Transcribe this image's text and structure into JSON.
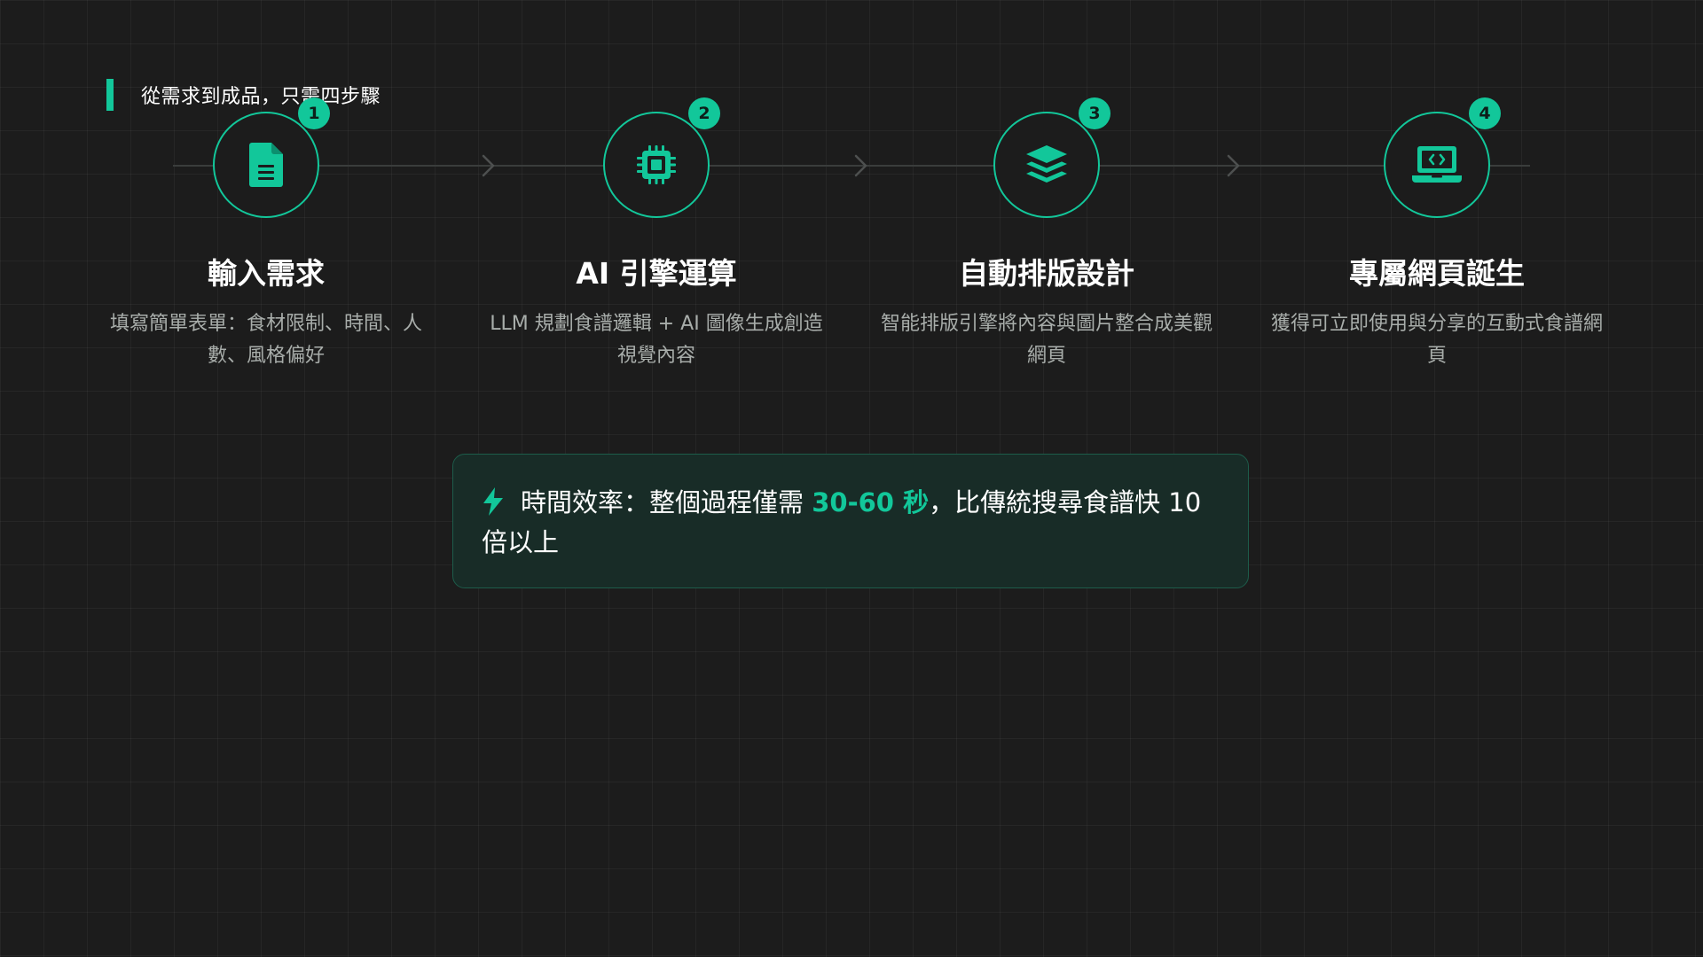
{
  "section": {
    "heading": "從需求到成品，只需四步驟"
  },
  "steps": [
    {
      "number": "1",
      "icon": "document-icon",
      "title": "輸入需求",
      "description": "填寫簡單表單：食材限制、時間、人數、風格偏好"
    },
    {
      "number": "2",
      "icon": "cpu-chip-icon",
      "title": "AI 引擎運算",
      "description": "LLM 規劃食譜邏輯 + AI 圖像生成創造視覺內容"
    },
    {
      "number": "3",
      "icon": "layers-icon",
      "title": "自動排版設計",
      "description": "智能排版引擎將內容與圖片整合成美觀網頁"
    },
    {
      "number": "4",
      "icon": "laptop-code-icon",
      "title": "專屬網頁誕生",
      "description": "獲得可立即使用與分享的互動式食譜網頁"
    }
  ],
  "callout": {
    "icon": "lightning-bolt-icon",
    "prefix": "時間效率：整個過程僅需 ",
    "highlight": "30-60 秒",
    "suffix": "，比傳統搜尋食譜快 10 倍以上"
  },
  "colors": {
    "accent": "#12c79a",
    "background": "#1c1c1c",
    "callout_background": "#182c27",
    "description_text": "#a8adaa"
  }
}
